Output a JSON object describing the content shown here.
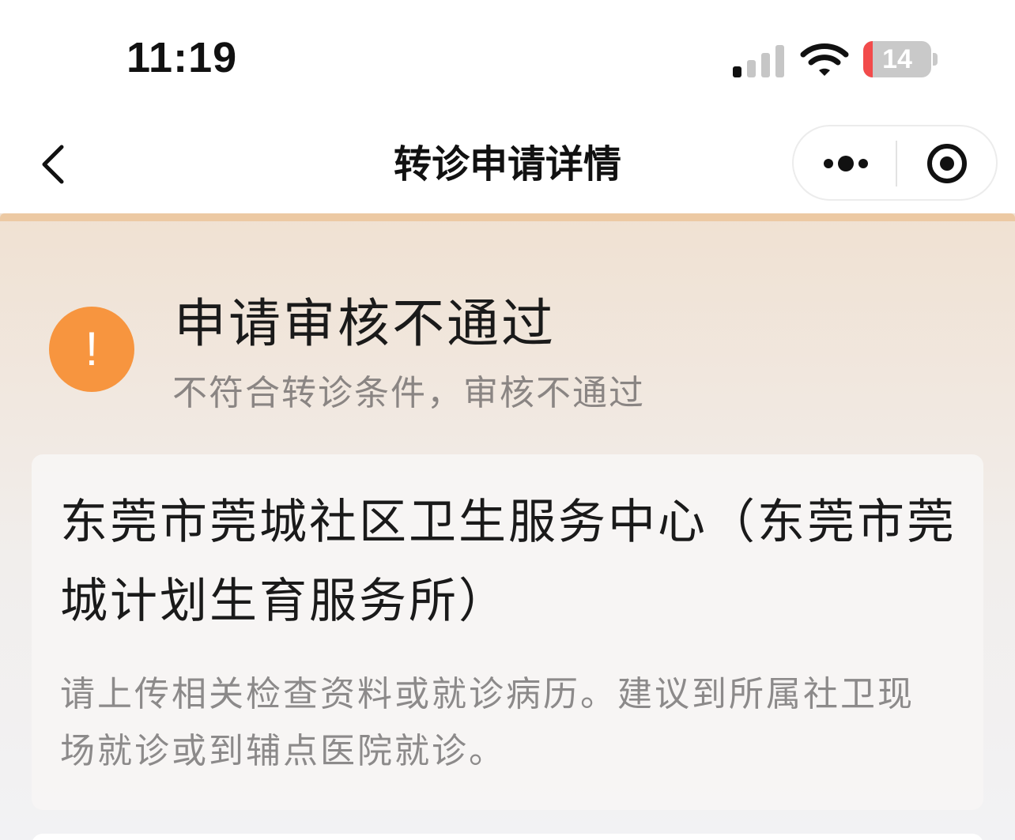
{
  "status_bar": {
    "time": "11:19",
    "battery_level": "14",
    "battery_fraction": 0.14
  },
  "nav": {
    "title": "转诊申请详情",
    "back_icon": "chevron-left-icon",
    "more_icon": "more-dots-icon",
    "close_icon": "target-close-icon"
  },
  "status": {
    "icon": "exclamation-icon",
    "icon_color": "#f7953f",
    "icon_text": "!",
    "title": "申请审核不通过",
    "subtitle": "不符合转诊条件，审核不通过"
  },
  "card": {
    "institution": "东莞市莞城社区卫生服务中心（东莞市莞城计划生育服务所）",
    "note": "请上传相关检查资料或就诊病历。建议到所属社卫现场就诊或到辅点医院就诊。"
  },
  "colors": {
    "battery_low": "#f24b4b",
    "header_accent": "#ecc9a3"
  }
}
